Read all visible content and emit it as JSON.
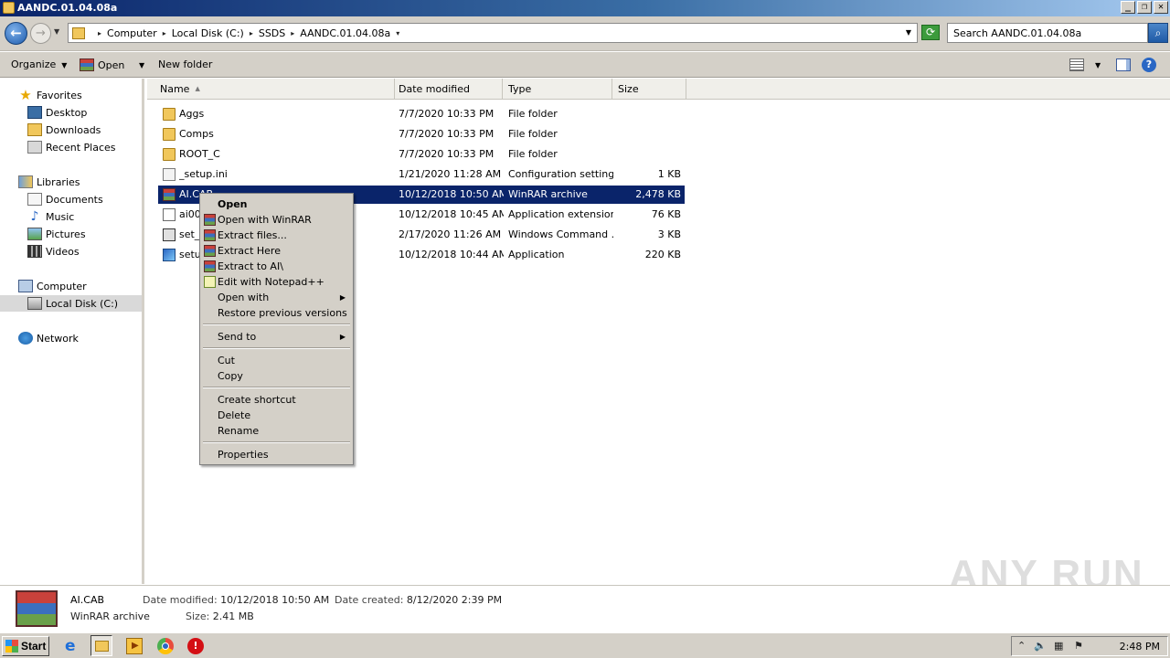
{
  "window": {
    "title": "AANDC.01.04.08a"
  },
  "address": {
    "segments": [
      "Computer",
      "Local Disk (C:)",
      "SSDS",
      "AANDC.01.04.08a"
    ],
    "search_placeholder": "Search AANDC.01.04.08a"
  },
  "toolbar": {
    "organize": "Organize",
    "open": "Open",
    "new_folder": "New folder"
  },
  "nav": {
    "favorites": "Favorites",
    "desktop": "Desktop",
    "downloads": "Downloads",
    "recent": "Recent Places",
    "libraries": "Libraries",
    "documents": "Documents",
    "music": "Music",
    "pictures": "Pictures",
    "videos": "Videos",
    "computer": "Computer",
    "local_disk": "Local Disk (C:)",
    "network": "Network"
  },
  "columns": {
    "name": "Name",
    "date": "Date modified",
    "type": "Type",
    "size": "Size"
  },
  "files": [
    {
      "name": "Aggs",
      "date": "7/7/2020 10:33 PM",
      "type": "File folder",
      "size": ""
    },
    {
      "name": "Comps",
      "date": "7/7/2020 10:33 PM",
      "type": "File folder",
      "size": ""
    },
    {
      "name": "ROOT_C",
      "date": "7/7/2020 10:33 PM",
      "type": "File folder",
      "size": ""
    },
    {
      "name": "_setup.ini",
      "date": "1/21/2020 11:28 AM",
      "type": "Configuration settings",
      "size": "1 KB"
    },
    {
      "name": "AI.CAB",
      "date": "10/12/2018 10:50 AM",
      "type": "WinRAR archive",
      "size": "2,478 KB"
    },
    {
      "name": "ai000",
      "date": "10/12/2018 10:45 AM",
      "type": "Application extension",
      "size": "76 KB"
    },
    {
      "name": "set_",
      "date": "2/17/2020 11:26 AM",
      "type": "Windows Command ...",
      "size": "3 KB"
    },
    {
      "name": "setu",
      "date": "10/12/2018 10:44 AM",
      "type": "Application",
      "size": "220 KB"
    }
  ],
  "context_menu": {
    "open": "Open",
    "open_winrar": "Open with WinRAR",
    "extract_files": "Extract files...",
    "extract_here": "Extract Here",
    "extract_to": "Extract to AI\\",
    "edit_npp": "Edit with Notepad++",
    "open_with": "Open with",
    "restore": "Restore previous versions",
    "send_to": "Send to",
    "cut": "Cut",
    "copy": "Copy",
    "create_shortcut": "Create shortcut",
    "delete": "Delete",
    "rename": "Rename",
    "properties": "Properties"
  },
  "details": {
    "name": "AI.CAB",
    "type": "WinRAR archive",
    "modified_label": "Date modified:",
    "modified": "10/12/2018 10:50 AM",
    "created_label": "Date created:",
    "created": "8/12/2020 2:39 PM",
    "size_label": "Size:",
    "size": "2.41 MB"
  },
  "watermark": "ANY RUN",
  "taskbar": {
    "start": "Start",
    "clock": "2:48 PM"
  }
}
